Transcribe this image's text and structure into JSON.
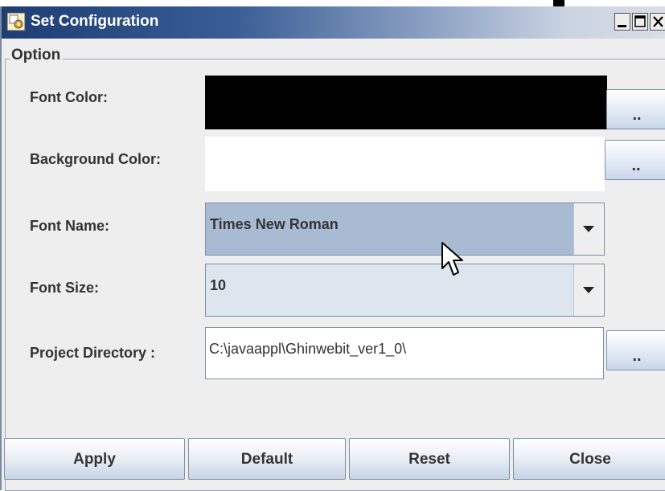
{
  "window": {
    "title": "Set Configuration",
    "titlebar_colors": [
      "#1d3d73",
      "#c9d3e2"
    ]
  },
  "group": {
    "label": "Option"
  },
  "rows": {
    "font_color": {
      "label": "Font Color:",
      "color": "#000000",
      "picker_label": ".."
    },
    "background_color": {
      "label": "Background Color:",
      "color": "#ffffff",
      "picker_label": ".."
    },
    "font_name": {
      "label": "Font Name:",
      "value": "Times New Roman",
      "state": "hovered"
    },
    "font_size": {
      "label": "Font Size:",
      "value": "10"
    },
    "project_directory": {
      "label": "Project Directory :",
      "value": "C:\\javaappl\\Ghinwebit_ver1_0\\",
      "browse_label": ".."
    }
  },
  "buttons": {
    "apply": "Apply",
    "default": "Default",
    "reset": "Reset",
    "close": "Close"
  },
  "icons": {
    "app": "config-app-icon",
    "minimize": "minimize-icon",
    "maximize": "maximize-icon",
    "close": "close-icon",
    "dropdown": "chevron-down-icon",
    "cursor": "mouse-pointer-icon"
  },
  "colors": {
    "combo_hover": "#a9bbd3",
    "combo_normal": "#dde5ef",
    "panel": "#eeeeee"
  }
}
